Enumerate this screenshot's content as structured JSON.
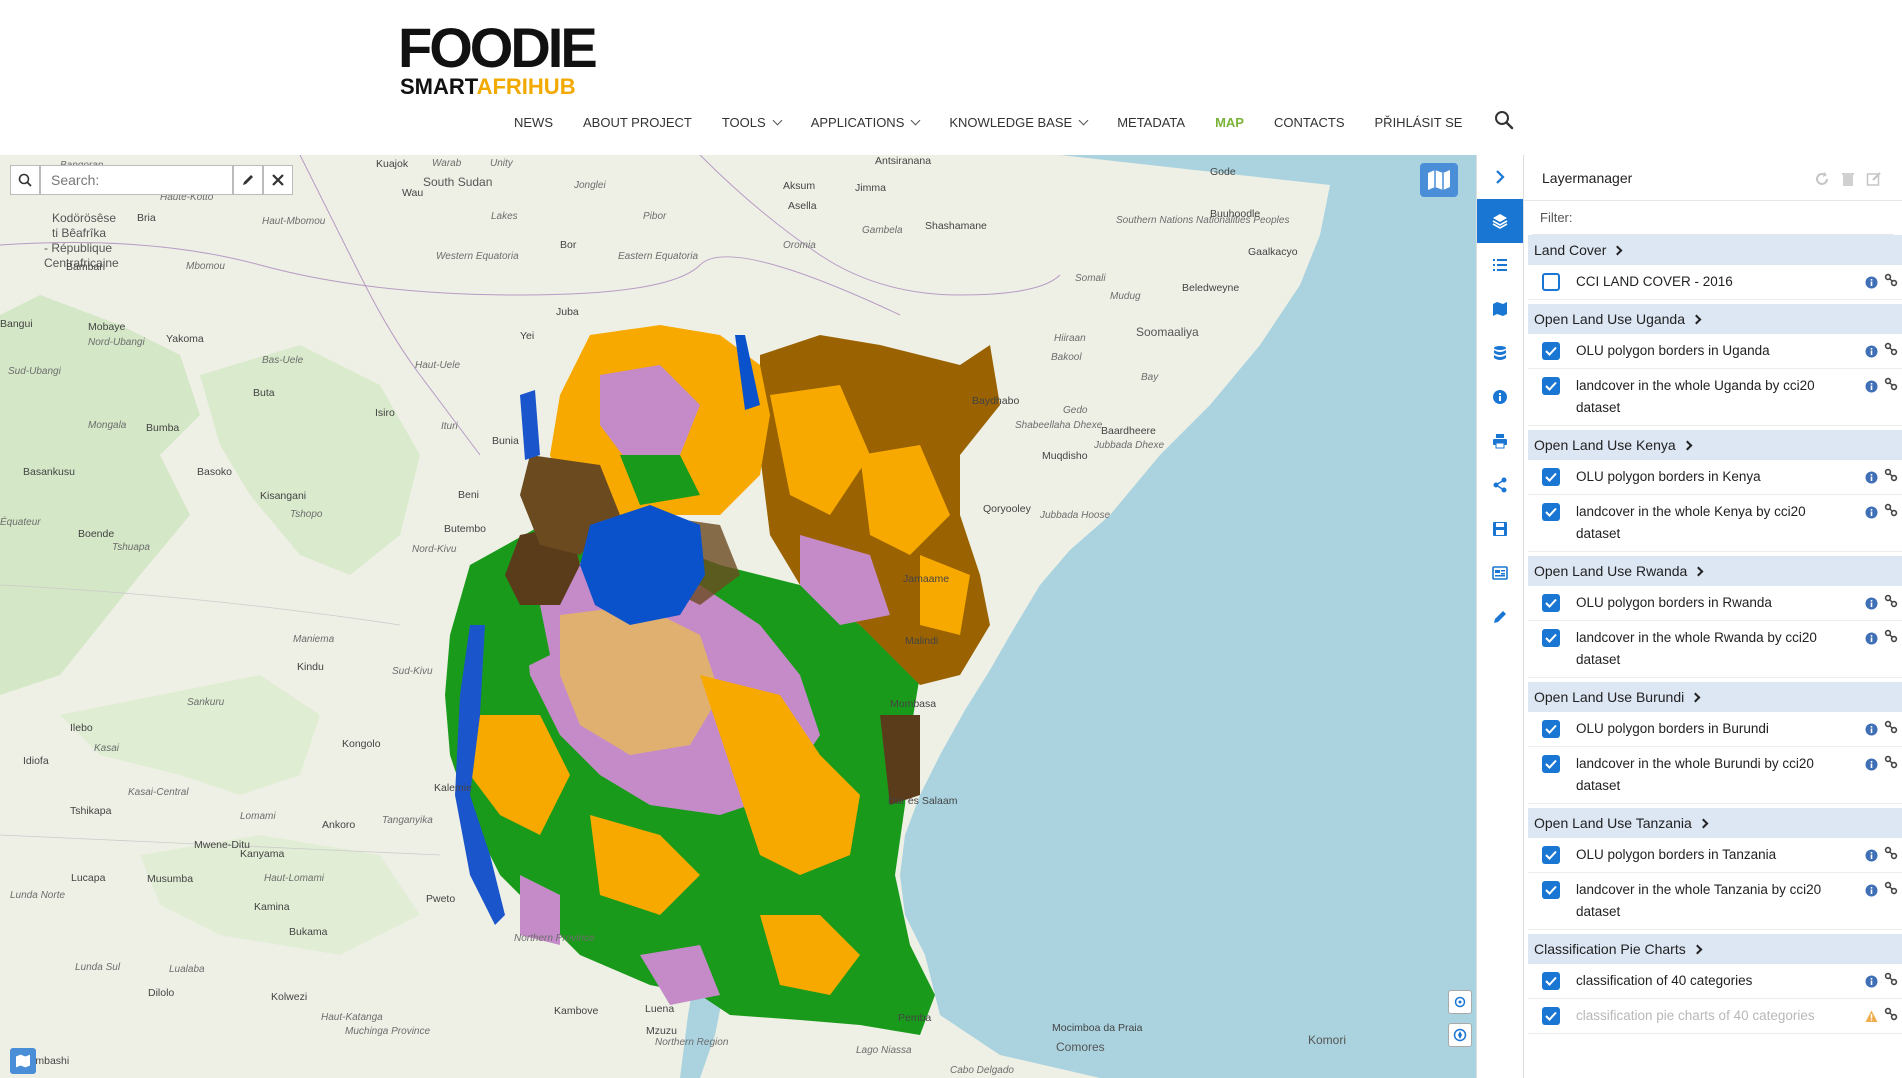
{
  "logo": {
    "top": "FOODIE",
    "bottom_a": "SMART",
    "bottom_b": "AFRIHUB"
  },
  "nav": [
    {
      "label": "NEWS",
      "dropdown": false,
      "active": false
    },
    {
      "label": "ABOUT PROJECT",
      "dropdown": false,
      "active": false
    },
    {
      "label": "TOOLS",
      "dropdown": true,
      "active": false
    },
    {
      "label": "APPLICATIONS",
      "dropdown": true,
      "active": false
    },
    {
      "label": "KNOWLEDGE BASE",
      "dropdown": true,
      "active": false
    },
    {
      "label": "METADATA",
      "dropdown": false,
      "active": false
    },
    {
      "label": "MAP",
      "dropdown": false,
      "active": true
    },
    {
      "label": "CONTACTS",
      "dropdown": false,
      "active": false
    },
    {
      "label": "PŘIHLÁSIT SE",
      "dropdown": false,
      "active": false
    }
  ],
  "map": {
    "search_placeholder": "Search:",
    "labels": [
      {
        "text": "Bangoran",
        "cls": ""
      },
      {
        "text": "Kuajok",
        "cls": "city"
      },
      {
        "text": "Warab",
        "cls": ""
      },
      {
        "text": "Unity",
        "cls": ""
      },
      {
        "text": "South Sudan",
        "cls": "big"
      },
      {
        "text": "Jonglei",
        "cls": ""
      },
      {
        "text": "Wau",
        "cls": "city"
      },
      {
        "text": "Haute-Kotto",
        "cls": ""
      },
      {
        "text": "Kodörösêse",
        "cls": "big"
      },
      {
        "text": "ti Bêafrîka",
        "cls": "big"
      },
      {
        "text": "- République",
        "cls": "big"
      },
      {
        "text": "Centrafricaine",
        "cls": "big"
      },
      {
        "text": "Bria",
        "cls": "city"
      },
      {
        "text": "Haut-Mbomou",
        "cls": ""
      },
      {
        "text": "Lakes",
        "cls": ""
      },
      {
        "text": "Pibor",
        "cls": ""
      },
      {
        "text": "Bor",
        "cls": "city"
      },
      {
        "text": "Bambari",
        "cls": "city"
      },
      {
        "text": "Mbomou",
        "cls": ""
      },
      {
        "text": "Western Equatoria",
        "cls": ""
      },
      {
        "text": "Eastern Equatoria",
        "cls": ""
      },
      {
        "text": "Juba",
        "cls": "city"
      },
      {
        "text": "Bangui",
        "cls": "city"
      },
      {
        "text": "Mobaye",
        "cls": "city"
      },
      {
        "text": "Nord-Ubangi",
        "cls": ""
      },
      {
        "text": "Yakoma",
        "cls": "city"
      },
      {
        "text": "Bas-Uele",
        "cls": ""
      },
      {
        "text": "Haut-Uele",
        "cls": ""
      },
      {
        "text": "Yei",
        "cls": "city"
      },
      {
        "text": "Sud-Ubangi",
        "cls": ""
      },
      {
        "text": "Buta",
        "cls": "city"
      },
      {
        "text": "Isiro",
        "cls": "city"
      },
      {
        "text": "Mongala",
        "cls": ""
      },
      {
        "text": "Bumba",
        "cls": "city"
      },
      {
        "text": "Ituri",
        "cls": ""
      },
      {
        "text": "Bunia",
        "cls": "city"
      },
      {
        "text": "Basankusu",
        "cls": "city"
      },
      {
        "text": "Basoko",
        "cls": "city"
      },
      {
        "text": "Kisangani",
        "cls": "city"
      },
      {
        "text": "Tshopo",
        "cls": ""
      },
      {
        "text": "Beni",
        "cls": "city"
      },
      {
        "text": "Équateur",
        "cls": ""
      },
      {
        "text": "Boende",
        "cls": "city"
      },
      {
        "text": "Tshuapa",
        "cls": ""
      },
      {
        "text": "Nord-Kivu",
        "cls": ""
      },
      {
        "text": "Butembo",
        "cls": "city"
      },
      {
        "text": "Maniema",
        "cls": ""
      },
      {
        "text": "Kindu",
        "cls": "city"
      },
      {
        "text": "Sud-Kivu",
        "cls": ""
      },
      {
        "text": "Sankuru",
        "cls": ""
      },
      {
        "text": "Ilebo",
        "cls": "city"
      },
      {
        "text": "Kasai",
        "cls": ""
      },
      {
        "text": "Kongolo",
        "cls": "city"
      },
      {
        "text": "Idiofa",
        "cls": "city"
      },
      {
        "text": "Kalemie",
        "cls": "city"
      },
      {
        "text": "Tshikapa",
        "cls": "city"
      },
      {
        "text": "Kasai-Central",
        "cls": ""
      },
      {
        "text": "Lomami",
        "cls": ""
      },
      {
        "text": "Ankoro",
        "cls": "city"
      },
      {
        "text": "Tanganyika",
        "cls": ""
      },
      {
        "text": "Mwene-Ditu",
        "cls": "city"
      },
      {
        "text": "Kanyama",
        "cls": "city"
      },
      {
        "text": "Lucapa",
        "cls": "city"
      },
      {
        "text": "Musumba",
        "cls": "city"
      },
      {
        "text": "Haut-Lomami",
        "cls": ""
      },
      {
        "text": "Lunda Norte",
        "cls": ""
      },
      {
        "text": "Kamina",
        "cls": "city"
      },
      {
        "text": "Pweto",
        "cls": "city"
      },
      {
        "text": "Bukama",
        "cls": "city"
      },
      {
        "text": "Northern Province",
        "cls": ""
      },
      {
        "text": "Lunda Sul",
        "cls": ""
      },
      {
        "text": "Lualaba",
        "cls": ""
      },
      {
        "text": "Dilolo",
        "cls": "city"
      },
      {
        "text": "Kolwezi",
        "cls": "city"
      },
      {
        "text": "Haut-Katanga",
        "cls": ""
      },
      {
        "text": "Kambove",
        "cls": "city"
      },
      {
        "text": "Muchinga Province",
        "cls": ""
      },
      {
        "text": "Lubumbashi",
        "cls": "city"
      },
      {
        "text": "Luena",
        "cls": "city"
      },
      {
        "text": "Mzuzu",
        "cls": "city"
      },
      {
        "text": "Northern Region",
        "cls": ""
      },
      {
        "text": "Lago Niassa",
        "cls": ""
      },
      {
        "text": "Cabo Delgado",
        "cls": ""
      },
      {
        "text": "Pemba",
        "cls": "city"
      },
      {
        "text": "Mocimboa da Praia",
        "cls": "city"
      },
      {
        "text": "Comores",
        "cls": "big"
      },
      {
        "text": "Komori",
        "cls": "big"
      },
      {
        "text": "Antsiranana",
        "cls": "city"
      },
      {
        "text": "Aksum",
        "cls": "city"
      },
      {
        "text": "Jimma",
        "cls": "city"
      },
      {
        "text": "Asella",
        "cls": "city"
      },
      {
        "text": "Gambela",
        "cls": ""
      },
      {
        "text": "Shashamane",
        "cls": "city"
      },
      {
        "text": "Oromia",
        "cls": ""
      },
      {
        "text": "Southern Nations Nationalities Peoples",
        "cls": ""
      },
      {
        "text": "Somali",
        "cls": ""
      },
      {
        "text": "Gode",
        "cls": "city"
      },
      {
        "text": "Buuhoodle",
        "cls": "city"
      },
      {
        "text": "Gaalkacyo",
        "cls": "city"
      },
      {
        "text": "Mudug",
        "cls": ""
      },
      {
        "text": "Beledweyne",
        "cls": "city"
      },
      {
        "text": "Soomaaliya",
        "cls": "big"
      },
      {
        "text": "Hiiraan",
        "cls": ""
      },
      {
        "text": "Bakool",
        "cls": ""
      },
      {
        "text": "Baydhabo",
        "cls": "city"
      },
      {
        "text": "Gedo",
        "cls": ""
      },
      {
        "text": "Bay",
        "cls": ""
      },
      {
        "text": "Shabeellaha Dhexe",
        "cls": ""
      },
      {
        "text": "Baardheere",
        "cls": "city"
      },
      {
        "text": "Muqdisho",
        "cls": "city"
      },
      {
        "text": "Jubbada Dhexe",
        "cls": ""
      },
      {
        "text": "Qoryooley",
        "cls": "city"
      },
      {
        "text": "Jubbada Hoose",
        "cls": ""
      },
      {
        "text": "Jamaame",
        "cls": "city"
      },
      {
        "text": "Mombasa",
        "cls": "city"
      },
      {
        "text": "Dar es Salaam",
        "cls": "city"
      },
      {
        "text": "Malindi",
        "cls": "city"
      }
    ]
  },
  "toolbar": [
    {
      "name": "collapse-arrow-icon",
      "active": false
    },
    {
      "name": "layers-icon",
      "active": true
    },
    {
      "name": "list-icon",
      "active": false
    },
    {
      "name": "map-icon",
      "active": false
    },
    {
      "name": "database-icon",
      "active": false
    },
    {
      "name": "info-icon",
      "active": false
    },
    {
      "name": "print-icon",
      "active": false
    },
    {
      "name": "share-icon",
      "active": false
    },
    {
      "name": "save-icon",
      "active": false
    },
    {
      "name": "compositions-icon",
      "active": false
    },
    {
      "name": "draw-icon",
      "active": false
    }
  ],
  "layermanager": {
    "title": "Layermanager",
    "filter_placeholder": "Filter:",
    "groups": [
      {
        "title": "Land Cover",
        "layers": [
          {
            "name": "CCI LAND COVER - 2016",
            "checked": false,
            "warning": false
          }
        ]
      },
      {
        "title": "Open Land Use Uganda",
        "layers": [
          {
            "name": "OLU polygon borders in Uganda",
            "checked": true,
            "warning": false
          },
          {
            "name": "landcover in the whole Uganda by cci20 dataset",
            "checked": true,
            "warning": false
          }
        ]
      },
      {
        "title": "Open Land Use Kenya",
        "layers": [
          {
            "name": "OLU polygon borders in Kenya",
            "checked": true,
            "warning": false
          },
          {
            "name": "landcover in the whole Kenya by cci20 dataset",
            "checked": true,
            "warning": false
          }
        ]
      },
      {
        "title": "Open Land Use Rwanda",
        "layers": [
          {
            "name": "OLU polygon borders in Rwanda",
            "checked": true,
            "warning": false
          },
          {
            "name": "landcover in the whole Rwanda by cci20 dataset",
            "checked": true,
            "warning": false
          }
        ]
      },
      {
        "title": "Open Land Use Burundi",
        "layers": [
          {
            "name": "OLU polygon borders in Burundi",
            "checked": true,
            "warning": false
          },
          {
            "name": "landcover in the whole Burundi by cci20 dataset",
            "checked": true,
            "warning": false
          }
        ]
      },
      {
        "title": "Open Land Use Tanzania",
        "layers": [
          {
            "name": "OLU polygon borders in Tanzania",
            "checked": true,
            "warning": false
          },
          {
            "name": "landcover in the whole Tanzania by cci20 dataset",
            "checked": true,
            "warning": false
          }
        ]
      },
      {
        "title": "Classification Pie Charts",
        "layers": [
          {
            "name": "classification of 40 categories",
            "checked": true,
            "warning": false
          },
          {
            "name": "classification pie charts of 40 categories",
            "checked": true,
            "warning": true
          }
        ]
      }
    ]
  },
  "colors": {
    "accent": "#1976d2",
    "active_nav": "#7bb33a",
    "sea": "#aad3df",
    "land": "#eef0e6"
  }
}
